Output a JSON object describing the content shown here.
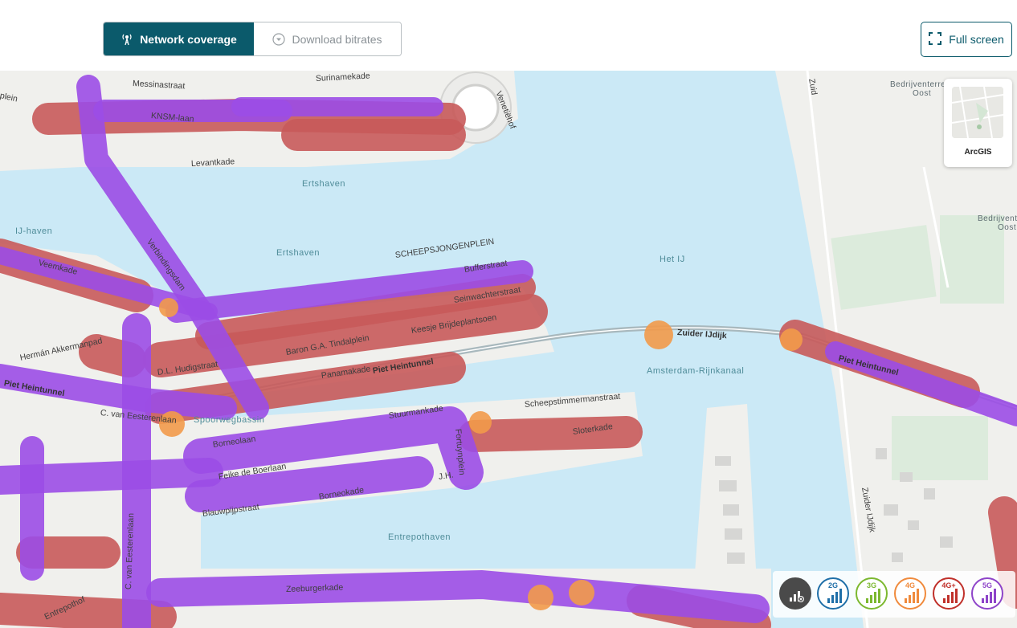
{
  "toolbar": {
    "tabs": [
      {
        "label": "Network coverage",
        "active": true,
        "icon": "antenna-icon"
      },
      {
        "label": "Download bitrates",
        "active": false,
        "icon": "download-circle-icon"
      }
    ],
    "fullscreen_label": "Full screen"
  },
  "map": {
    "water_labels": [
      "Ertshaven",
      "Ertshaven",
      "IJ-haven",
      "Het IJ",
      "Amsterdam-Rijnkanaal",
      "Spoorwegbassin",
      "Entrepothaven"
    ],
    "area_labels": [
      "Bedrijventerrein",
      "Oost",
      "Bedrijventer",
      "Oost"
    ],
    "streets": [
      "Messinastraat",
      "Surinamekade",
      "Venetiëhof",
      "KNSM-laan",
      "Levantkade",
      "plein",
      "Veemkade",
      "Verbindingsdam",
      "SCHEEPSJONGENPLEIN",
      "Bufferstraat",
      "Seinwachterstraat",
      "Keesje Brijdeplantsoen",
      "Baron G.A. Tindalplein",
      "Panamakade",
      "Piet Heintunnel",
      "Hermán Akkermanpad",
      "D.L. Hudigstraat",
      "Piet Heintunnel",
      "C. van Eesterenlaan",
      "Zuider IJdijk",
      "Piet Heintunnel",
      "Scheepstimmermanstraat",
      "Stuurmankade",
      "Sloterkade",
      "Borneolaan",
      "Feike de Boerlaan",
      "Fortuynplein",
      "J.H.",
      "Borneokade",
      "Blauwpijpstraat",
      "C. van Eesterenlaan",
      "Zeeburgerkade",
      "Entrepothof",
      "Zuider IJdijk",
      "Zuid"
    ]
  },
  "basemap": {
    "label": "ArcGIS"
  },
  "legend": {
    "items": [
      {
        "label": "",
        "name": "all-networks",
        "color": "#4a4a4a"
      },
      {
        "label": "2G",
        "name": "2g",
        "color": "#1f6fa8"
      },
      {
        "label": "3G",
        "name": "3g",
        "color": "#7cb82f"
      },
      {
        "label": "4G",
        "name": "4g",
        "color": "#f08a3c"
      },
      {
        "label": "4G+",
        "name": "4g-plus",
        "color": "#c0302a"
      },
      {
        "label": "5G",
        "name": "5g",
        "color": "#8e44c9"
      }
    ]
  }
}
